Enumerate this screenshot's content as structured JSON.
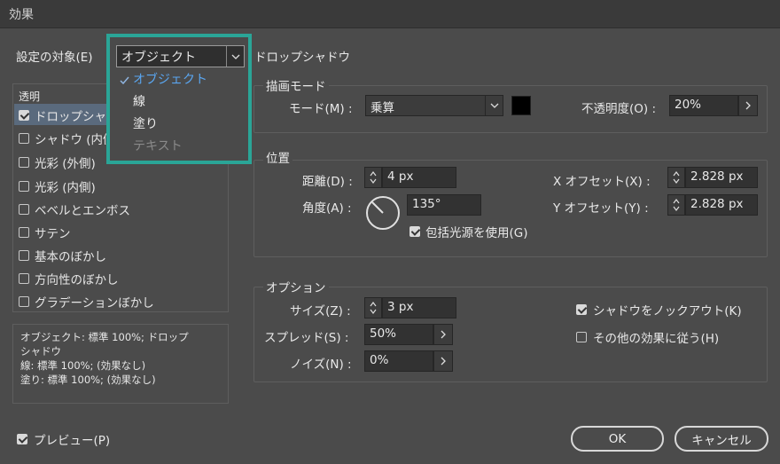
{
  "window": {
    "title": "効果"
  },
  "settings_target": {
    "label": "設定の対象(E)",
    "selected": "オブジェクト"
  },
  "popup_options": [
    {
      "label": "オブジェクト",
      "checked": true,
      "disabled": false
    },
    {
      "label": "線",
      "checked": false,
      "disabled": false
    },
    {
      "label": "塗り",
      "checked": false,
      "disabled": false
    },
    {
      "label": "テキスト",
      "checked": false,
      "disabled": true
    }
  ],
  "section_title": "ドロップシャドウ",
  "effects": {
    "header": "透明",
    "items": [
      {
        "label": "ドロップシャドウ",
        "checked": true
      },
      {
        "label": "シャドウ (内側)",
        "checked": false
      },
      {
        "label": "光彩 (外側)",
        "checked": false
      },
      {
        "label": "光彩 (内側)",
        "checked": false
      },
      {
        "label": "ベベルとエンボス",
        "checked": false
      },
      {
        "label": "サテン",
        "checked": false
      },
      {
        "label": "基本のぼかし",
        "checked": false
      },
      {
        "label": "方向性のぼかし",
        "checked": false
      },
      {
        "label": "グラデーションぼかし",
        "checked": false
      }
    ]
  },
  "summary": {
    "line1": "オブジェクト: 標準 100%; ドロップ",
    "line2": "シャドウ",
    "line3": "線: 標準 100%; (効果なし)",
    "line4": "塗り: 標準 100%; (効果なし)"
  },
  "blend": {
    "legend": "描画モード",
    "mode_label": "モード(M) :",
    "mode_value": "乗算",
    "swatch_color": "#000000",
    "opacity_label": "不透明度(O) :",
    "opacity_value": "20%"
  },
  "position": {
    "legend": "位置",
    "distance_label": "距離(D) :",
    "distance_value": "4 px",
    "angle_label": "角度(A) :",
    "angle_value": "135°",
    "global_light_label": "包括光源を使用(G)",
    "global_light_checked": true,
    "x_offset_label": "X オフセット(X) :",
    "x_offset_value": "2.828 px",
    "y_offset_label": "Y オフセット(Y) :",
    "y_offset_value": "2.828 px"
  },
  "options": {
    "legend": "オプション",
    "size_label": "サイズ(Z) :",
    "size_value": "3 px",
    "spread_label": "スプレッド(S) :",
    "spread_value": "50%",
    "noise_label": "ノイズ(N) :",
    "noise_value": "0%",
    "knockout_label": "シャドウをノックアウト(K)",
    "knockout_checked": true,
    "honor_label": "その他の効果に従う(H)",
    "honor_checked": false
  },
  "footer": {
    "preview_label": "プレビュー(P)",
    "preview_checked": true,
    "ok_label": "OK",
    "cancel_label": "キャンセル"
  }
}
